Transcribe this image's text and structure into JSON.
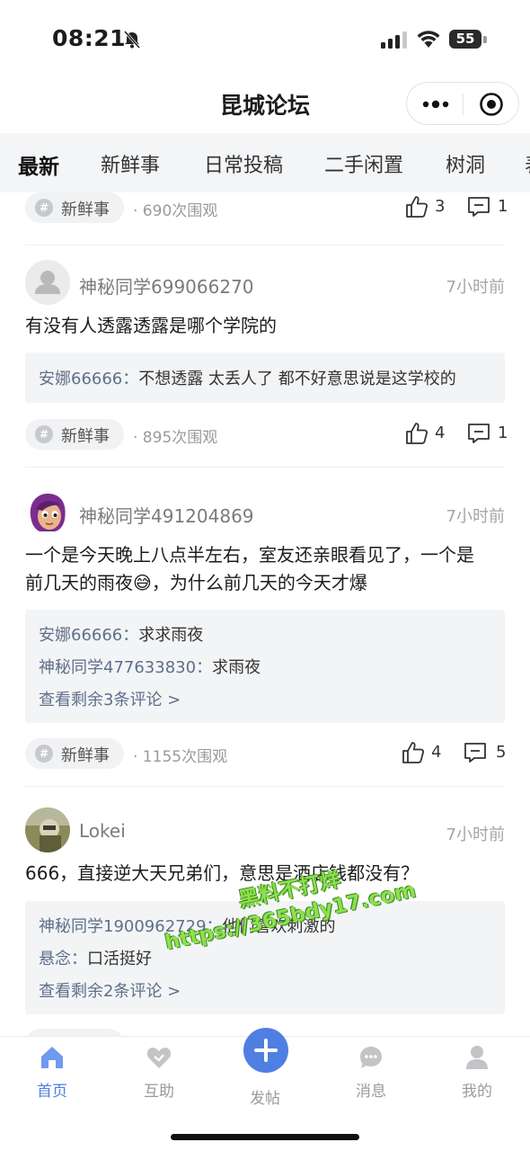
{
  "status_bar": {
    "time": "08:21",
    "battery": "55"
  },
  "header": {
    "title": "昆城论坛"
  },
  "tabs": [
    {
      "label": "最新",
      "active": true
    },
    {
      "label": "新鲜事",
      "active": false
    },
    {
      "label": "日常投稿",
      "active": false
    },
    {
      "label": "二手闲置",
      "active": false
    },
    {
      "label": "树洞",
      "active": false
    },
    {
      "label": "表",
      "active": false
    }
  ],
  "posts": [
    {
      "tag": "新鲜事",
      "views": "· 690次围观",
      "likes": "3",
      "comments_count": "1"
    },
    {
      "author": "神秘同学699066270",
      "time": "7小时前",
      "text": "有没有人透露透露是哪个学院的",
      "comments": [
        {
          "name": "安娜66666：",
          "text": "不想透露 太丢人了 都不好意思说是这学校的"
        }
      ],
      "tag": "新鲜事",
      "views": "· 895次围观",
      "likes": "4",
      "comments_count": "1"
    },
    {
      "author": "神秘同学491204869",
      "time": "7小时前",
      "text_line1": "一个是今天晚上八点半左右，室友还亲眼看见了，一个是",
      "text_line2": "前几天的雨夜😅，为什么前几天的今天才爆",
      "comments": [
        {
          "name": "安娜66666：",
          "text": "求求雨夜"
        },
        {
          "name": "神秘同学477633830：",
          "text": "求雨夜"
        }
      ],
      "more": "查看剩余3条评论 >",
      "tag": "新鲜事",
      "views": "· 1155次围观",
      "likes": "4",
      "comments_count": "5"
    },
    {
      "author": "Lokei",
      "time": "7小时前",
      "text": "666，直接逆大天兄弟们，意思是酒店钱都没有？",
      "comments": [
        {
          "name": "神秘同学1900962729：",
          "text": "他们喜欢刺激的"
        },
        {
          "name": "悬念：",
          "text": "口活挺好"
        }
      ],
      "more": "查看剩余2条评论 >"
    }
  ],
  "watermark": {
    "line1": "黑料不打烊",
    "line2": "https://365bdy17.com"
  },
  "nav": [
    {
      "label": "首页",
      "icon": "home-icon",
      "active": true
    },
    {
      "label": "互助",
      "icon": "heart-hands-icon",
      "active": false
    },
    {
      "label": "发帖",
      "icon": "plus-icon",
      "active": false
    },
    {
      "label": "消息",
      "icon": "chat-bubble-icon",
      "active": false
    },
    {
      "label": "我的",
      "icon": "person-icon",
      "active": false
    }
  ],
  "colors": {
    "accent": "#4f7fe3",
    "tab_bar_bg": "#f4f5f7",
    "comment_bg": "#f3f4f6"
  }
}
